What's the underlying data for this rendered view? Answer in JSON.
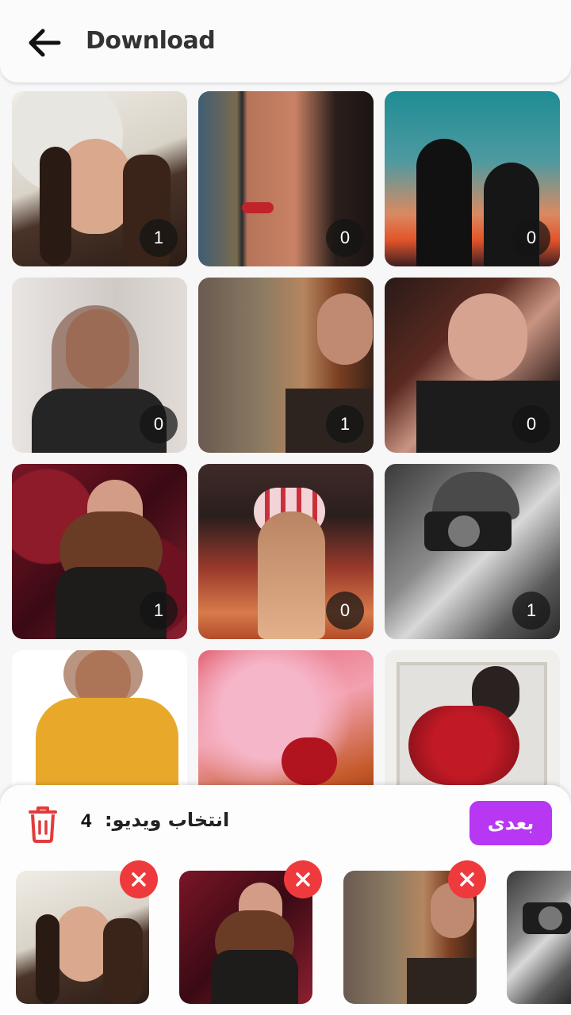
{
  "header": {
    "title": "Download",
    "back_icon": "arrow-left-icon"
  },
  "grid": {
    "tiles": [
      {
        "count": "1"
      },
      {
        "count": "0"
      },
      {
        "count": "0"
      },
      {
        "count": "0"
      },
      {
        "count": "1"
      },
      {
        "count": "0"
      },
      {
        "count": "1"
      },
      {
        "count": "0"
      },
      {
        "count": "1"
      },
      {
        "count": ""
      },
      {
        "count": ""
      },
      {
        "count": ""
      }
    ]
  },
  "selection": {
    "label": "انتخاب ویدیو:",
    "count": "4",
    "next_label": "بعدی",
    "delete_icon": "trash-icon",
    "remove_icon": "close-icon"
  },
  "colors": {
    "accent": "#b737f3",
    "remove": "#ef3a3d",
    "trash": "#e23b3b"
  }
}
